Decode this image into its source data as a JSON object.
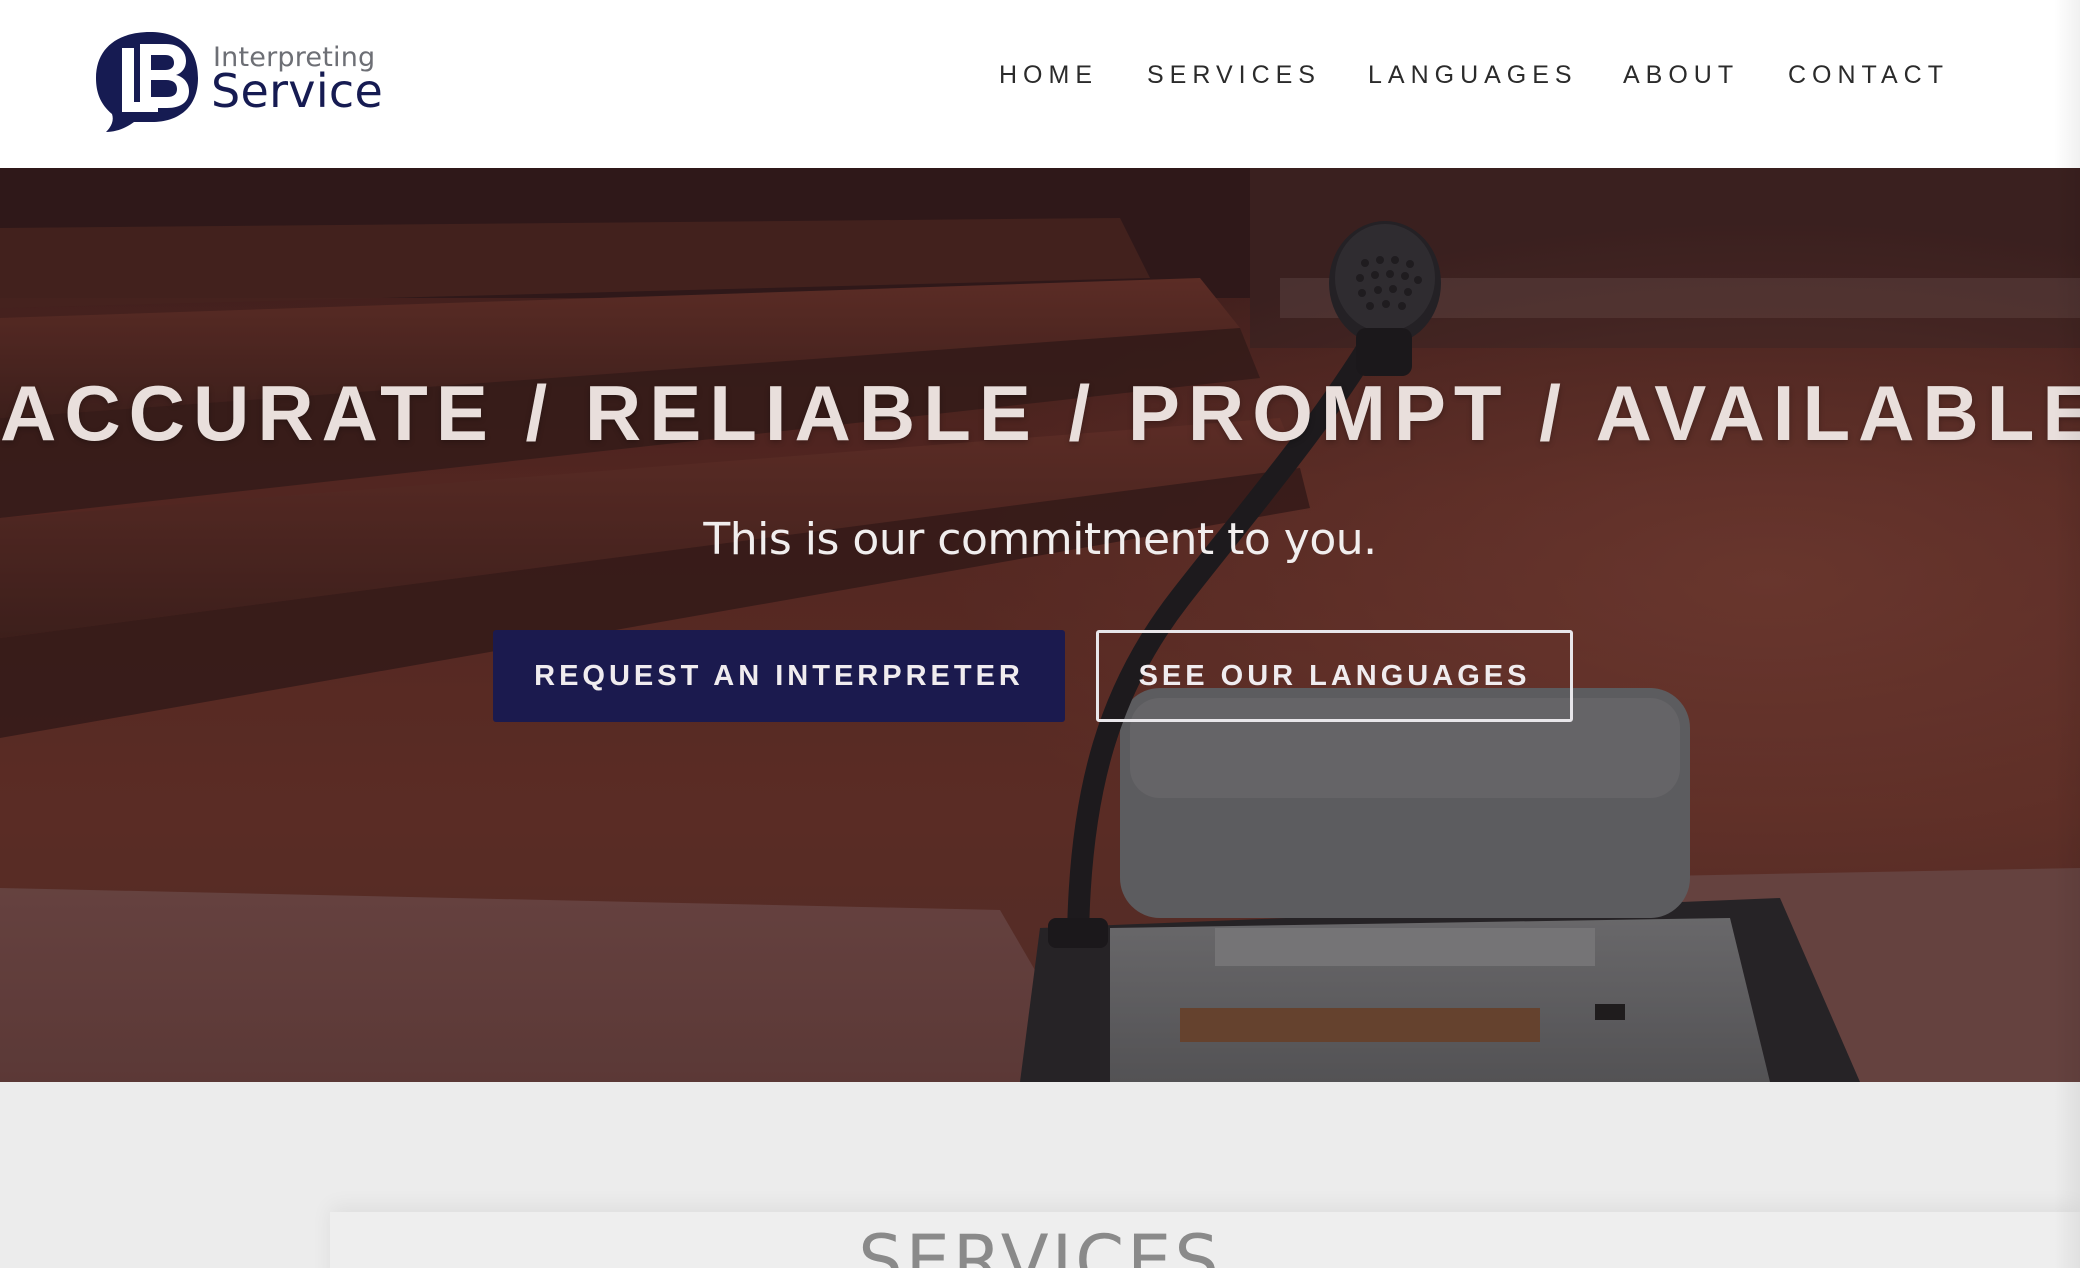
{
  "header": {
    "logo": {
      "mark_text": "LB",
      "small_text": "Interpreting",
      "big_text": "Service"
    },
    "nav": [
      {
        "label": "HOME"
      },
      {
        "label": "SERVICES"
      },
      {
        "label": "LANGUAGES"
      },
      {
        "label": "ABOUT"
      },
      {
        "label": "CONTACT"
      }
    ]
  },
  "hero": {
    "title": "ACCURATE / RELIABLE / PROMPT / AVAILABLE",
    "subtitle": "This is our commitment to you.",
    "primary_button": "REQUEST AN INTERPRETER",
    "secondary_button": "SEE OUR LANGUAGES"
  },
  "services": {
    "title": "SERVICES"
  },
  "colors": {
    "brand_navy": "#1b1a4e",
    "logo_navy": "#161b52",
    "nav_text": "#2b2b2b"
  }
}
